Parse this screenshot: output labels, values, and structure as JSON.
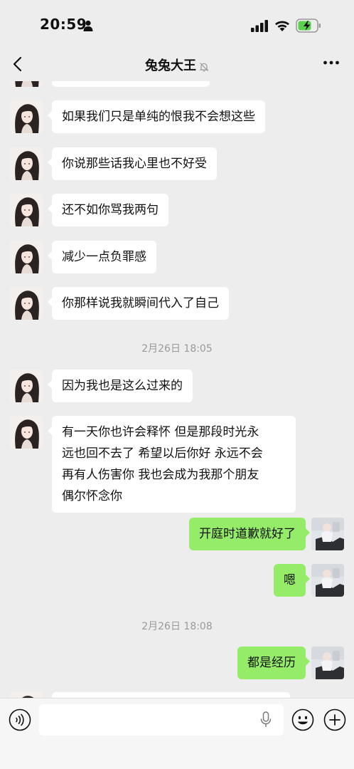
{
  "status_bar": {
    "time": "20:59"
  },
  "header": {
    "title": "兔兔大王"
  },
  "messages": [
    {
      "text": "如果我们只是单纯的恨我不会想这些"
    },
    {
      "text": "你说那些话我心里也不好受"
    },
    {
      "text": "还不如你骂我两句"
    },
    {
      "text": "减少一点负罪感"
    },
    {
      "text": "你那样说我就瞬间代入了自己"
    },
    {
      "timestamp": "2月26日 18:05"
    },
    {
      "text": "因为我也是这么过来的"
    },
    {
      "text": "有一天你也许会释怀 但是那段时光永\n远也回不去了 希望以后你好 永远不会\n再有人伤害你 我也会成为我那个朋友\n偶尔怀念你"
    },
    {
      "text": "开庭时道歉就好了"
    },
    {
      "text": "嗯"
    },
    {
      "timestamp": "2月26日 18:08"
    },
    {
      "text": "都是经历"
    }
  ],
  "input_bar": {
    "placeholder": ""
  },
  "colors": {
    "background": "#ededed",
    "outgoing_bubble": "#95ec69",
    "incoming_bubble": "#ffffff",
    "battery_fill": "#5ad04c"
  }
}
